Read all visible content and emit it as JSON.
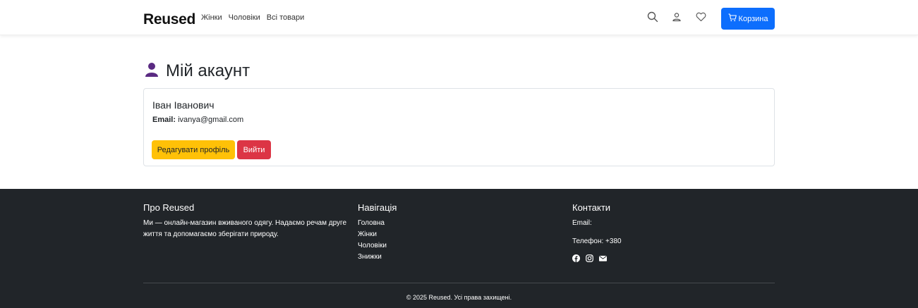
{
  "header": {
    "brand": "Reused",
    "nav": [
      "Жінки",
      "Чоловіки",
      "Всі товари"
    ],
    "cart_label": "Корзина",
    "icons": [
      "search-icon",
      "user-icon",
      "heart-icon",
      "cart-icon"
    ],
    "accent_color": "#0d6efd"
  },
  "main": {
    "title": "Мій акаунт",
    "title_icon": "user-icon",
    "title_icon_color": "#5a2a82",
    "user_name": "Іван Іванович",
    "email_label": "Email:",
    "email_value": "ivanya@gmail.com",
    "edit_button": "Редагувати профіль",
    "logout_button": "Вийти",
    "edit_color": "#ffc107",
    "logout_color": "#dc3545"
  },
  "footer": {
    "about_title": "Про Reused",
    "about_text": "Ми — онлайн-магазин вживаного одягу. Надаємо речам друге життя та допомагаємо зберігати природу.",
    "nav_title": "Навігація",
    "nav_items": [
      "Головна",
      "Жінки",
      "Чоловіки",
      "Знижки"
    ],
    "contacts_title": "Контакти",
    "email_label": "Email:",
    "phone_label": "Телефон: +380",
    "social_icons": [
      "facebook-icon",
      "instagram-icon",
      "mail-icon"
    ],
    "copyright": "© 2025 Reused. Усі права захищені.",
    "background": "#212529"
  }
}
